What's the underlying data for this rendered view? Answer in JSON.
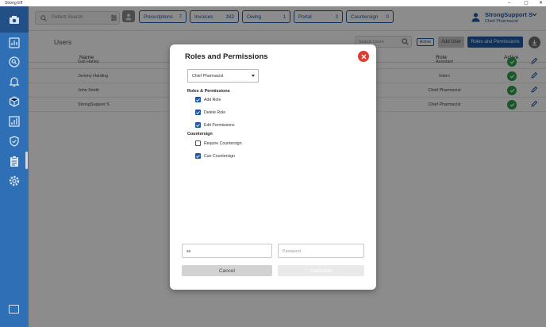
{
  "window": {
    "title": "Strong Eff",
    "controls": [
      "–",
      "▢",
      "✕"
    ]
  },
  "header": {
    "search_placeholder": "Patient Search",
    "tabs": [
      {
        "label": "Prescriptions",
        "count": "7"
      },
      {
        "label": "Invoices",
        "count": "182"
      },
      {
        "label": "Owing",
        "count": "1"
      },
      {
        "label": "Portal",
        "count": "3"
      },
      {
        "label": "Countersign",
        "count": "0"
      }
    ],
    "user": {
      "name": "StrongSupport S",
      "role": "Chief Pharmacist"
    }
  },
  "page": {
    "title": "Users",
    "search_placeholder": "Search Users",
    "active_label": "Active",
    "add_user_label": "Add User",
    "roles_label": "Roles and Permissions"
  },
  "table": {
    "columns": {
      "name": "Name",
      "role": "Role",
      "active": "Active"
    },
    "rows": [
      {
        "name": "Gail Harley",
        "role": "Assistant"
      },
      {
        "name": "Jeremy Harding",
        "role": "Intern"
      },
      {
        "name": "John Smith",
        "role": "Chief Pharmacist"
      },
      {
        "name": "StrongSupport S",
        "role": "Chief Pharmacist"
      }
    ]
  },
  "modal": {
    "title": "Roles and Permissions",
    "selected_role": "Chief Pharmacist",
    "section_roles": "Roles & Permissions",
    "roles_permissions": [
      {
        "label": "Add Role",
        "checked": true
      },
      {
        "label": "Delete Role",
        "checked": true
      },
      {
        "label": "Edit Permissions",
        "checked": true
      }
    ],
    "section_countersign": "Countersign",
    "countersign": [
      {
        "label": "Require Countersign",
        "checked": false
      },
      {
        "label": "Can Countersign",
        "checked": true
      }
    ],
    "username_value": "ss",
    "password_placeholder": "Password",
    "cancel_label": "Cancel",
    "complete_label": "Complete"
  },
  "colors": {
    "primary": "#1e5aa3",
    "sidebar": "#2f6fb5",
    "success": "#2e9e4a",
    "danger": "#e03b2e"
  }
}
